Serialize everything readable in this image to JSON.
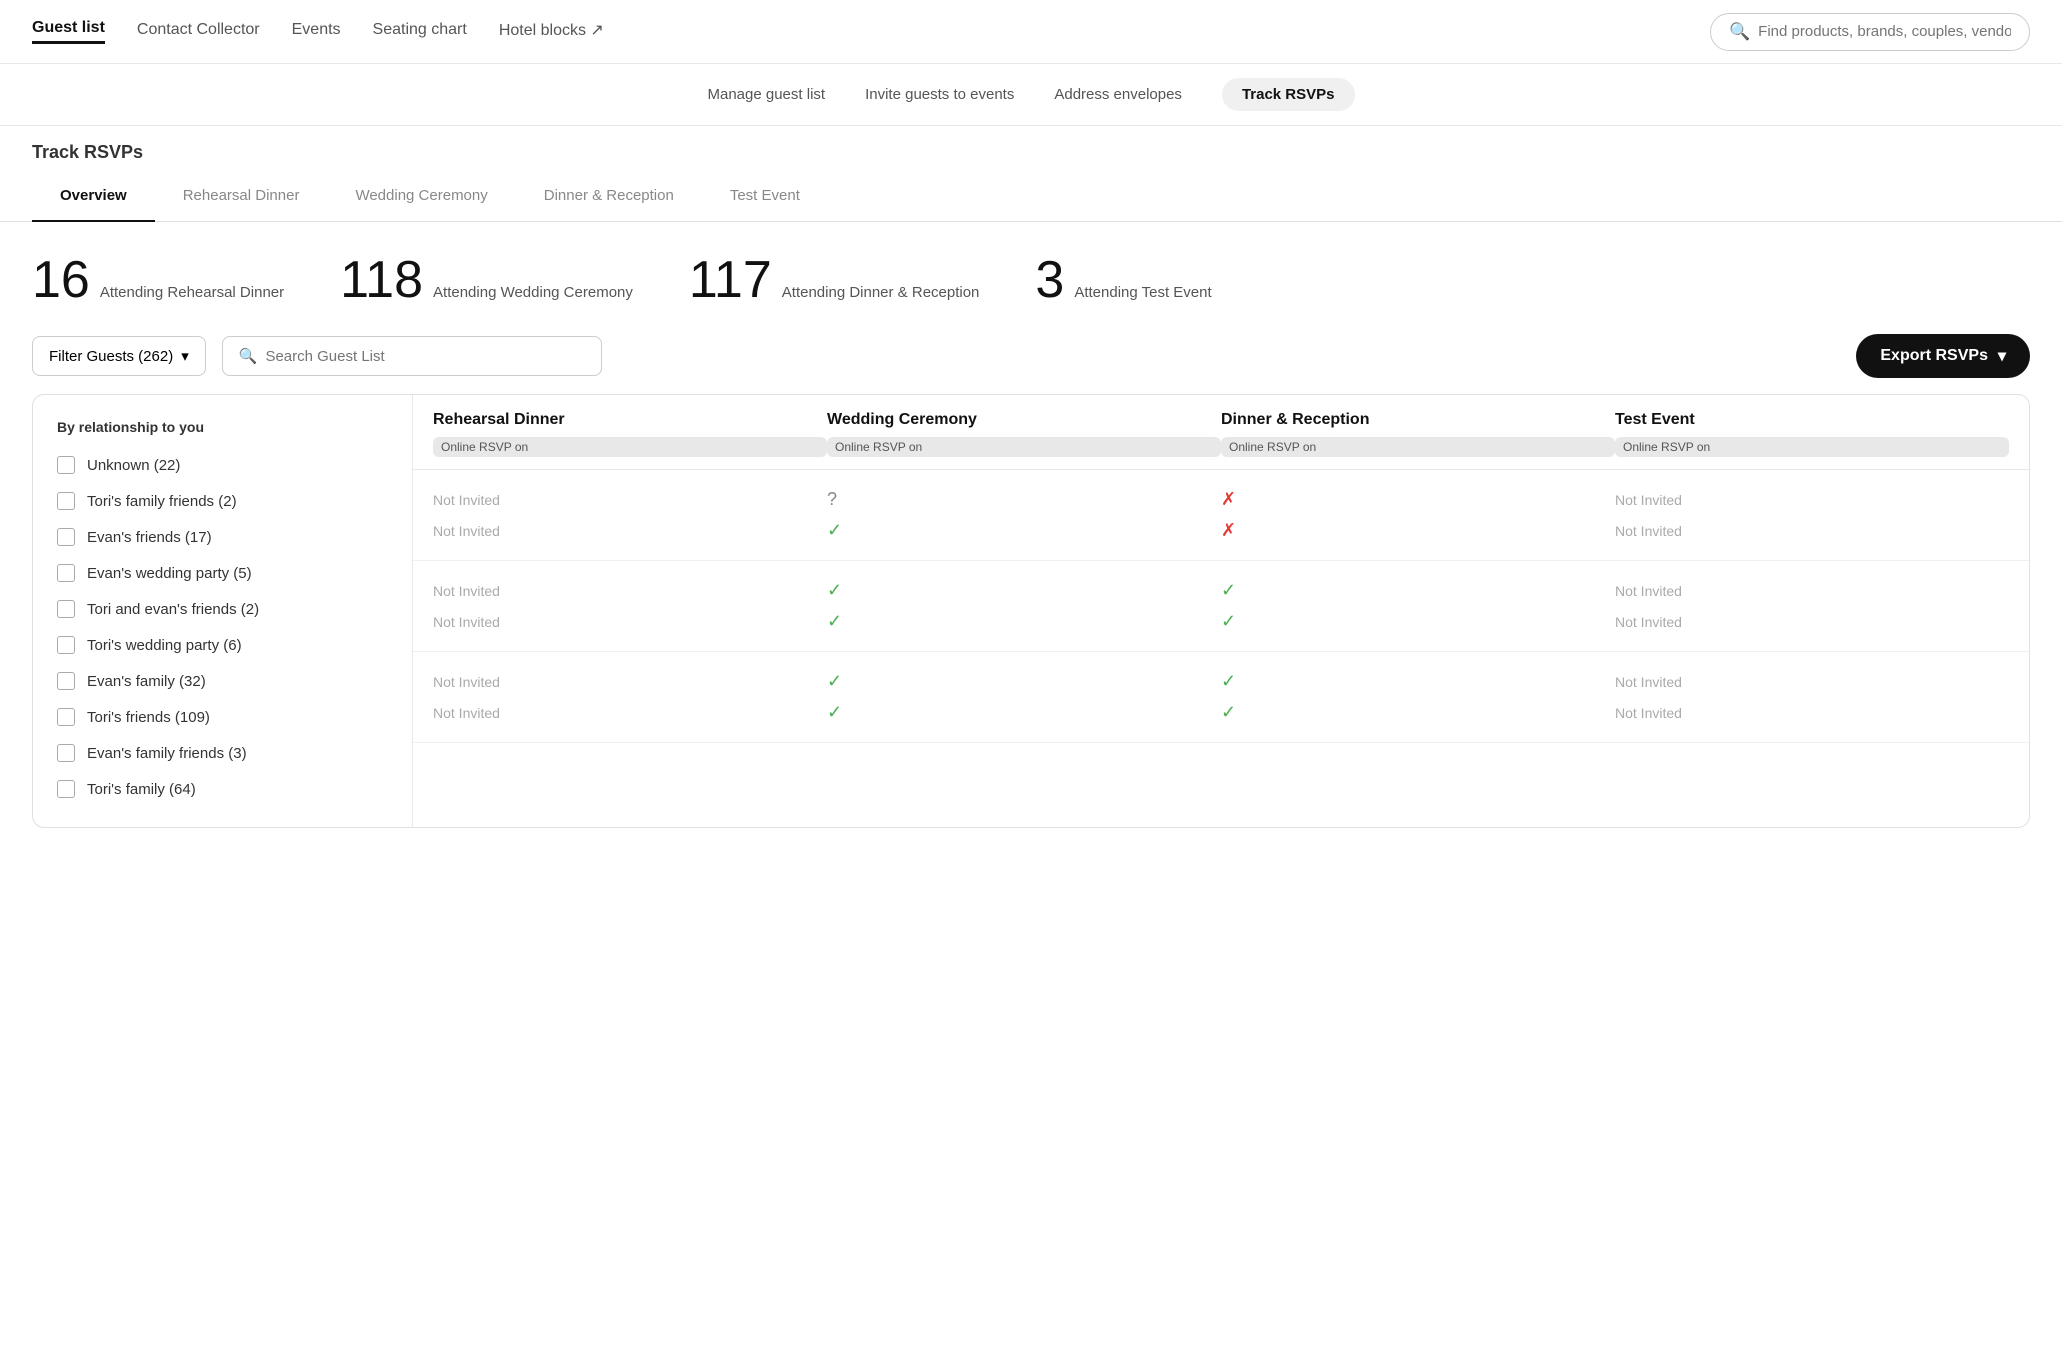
{
  "nav": {
    "items": [
      {
        "id": "guest-list",
        "label": "Guest list",
        "active": true
      },
      {
        "id": "contact-collector",
        "label": "Contact Collector",
        "active": false
      },
      {
        "id": "events",
        "label": "Events",
        "active": false
      },
      {
        "id": "seating-chart",
        "label": "Seating chart",
        "active": false
      },
      {
        "id": "hotel-blocks",
        "label": "Hotel blocks ↗",
        "active": false
      }
    ],
    "search_placeholder": "Find products, brands, couples, vendors..."
  },
  "sub_nav": {
    "items": [
      {
        "id": "manage",
        "label": "Manage guest list",
        "active": false
      },
      {
        "id": "invite",
        "label": "Invite guests to events",
        "active": false
      },
      {
        "id": "address",
        "label": "Address envelopes",
        "active": false
      },
      {
        "id": "track",
        "label": "Track RSVPs",
        "active": true
      }
    ]
  },
  "page_title": "Track RSVPs",
  "tabs": [
    {
      "id": "overview",
      "label": "Overview",
      "active": true
    },
    {
      "id": "rehearsal",
      "label": "Rehearsal Dinner",
      "active": false
    },
    {
      "id": "wedding",
      "label": "Wedding Ceremony",
      "active": false
    },
    {
      "id": "dinner",
      "label": "Dinner & Reception",
      "active": false
    },
    {
      "id": "test",
      "label": "Test Event",
      "active": false
    }
  ],
  "stats": [
    {
      "num": "16",
      "label": "Attending Rehearsal Dinner"
    },
    {
      "num": "118",
      "label": "Attending Wedding Ceremony"
    },
    {
      "num": "117",
      "label": "Attending Dinner & Reception"
    },
    {
      "num": "3",
      "label": "Attending Test Event"
    }
  ],
  "filter": {
    "label": "Filter Guests (262)",
    "search_placeholder": "Search Guest List",
    "export_label": "Export RSVPs"
  },
  "left_panel": {
    "section_title": "By relationship to you",
    "options": [
      {
        "label": "Unknown (22)"
      },
      {
        "label": "Tori's family friends (2)"
      },
      {
        "label": "Evan's friends (17)"
      },
      {
        "label": "Evan's wedding party (5)"
      },
      {
        "label": "Tori and evan's friends (2)"
      },
      {
        "label": "Tori's wedding party (6)"
      },
      {
        "label": "Evan's family (32)"
      },
      {
        "label": "Tori's friends (109)"
      },
      {
        "label": "Evan's family friends (3)"
      },
      {
        "label": "Tori's family (64)"
      }
    ]
  },
  "table": {
    "columns": [
      {
        "label": "Rehearsal Dinner",
        "badge": "Online RSVP on"
      },
      {
        "label": "Wedding Ceremony",
        "badge": "Online RSVP on"
      },
      {
        "label": "Dinner & Reception",
        "badge": "Online RSVP on"
      },
      {
        "label": "Test Event",
        "badge": "Online RSVP on"
      }
    ],
    "row_groups": [
      {
        "rows": [
          {
            "cells": [
              "Not Invited",
              "?",
              "✗",
              "Not Invited"
            ]
          },
          {
            "cells": [
              "Not Invited",
              "✓",
              "✗",
              "Not Invited"
            ]
          }
        ]
      },
      {
        "rows": [
          {
            "cells": [
              "Not Invited",
              "✓",
              "✓",
              "Not Invited"
            ]
          },
          {
            "cells": [
              "Not Invited",
              "✓",
              "✓",
              "Not Invited"
            ]
          }
        ]
      },
      {
        "rows": [
          {
            "cells": [
              "Not Invited",
              "✓",
              "✓",
              "Not Invited"
            ]
          },
          {
            "cells": [
              "Not Invited",
              "✓",
              "✓",
              "Not Invited"
            ]
          }
        ]
      }
    ]
  }
}
